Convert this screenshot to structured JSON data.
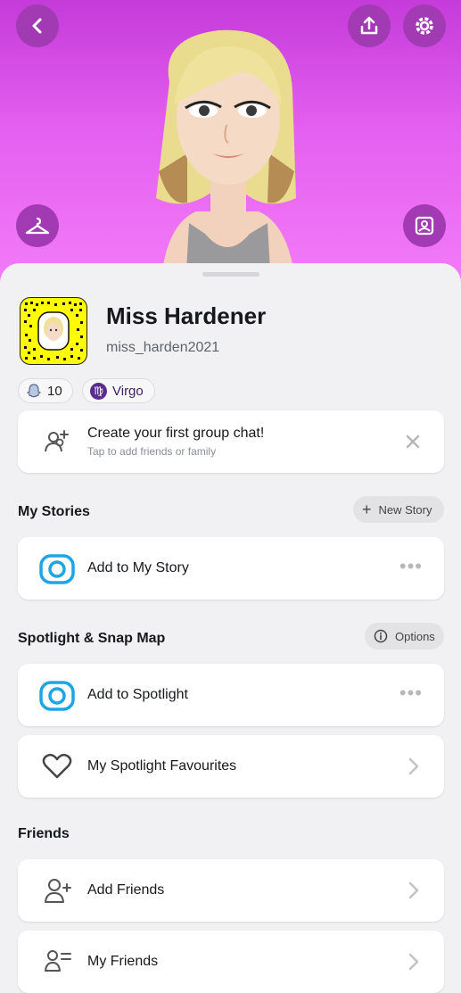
{
  "profile": {
    "display_name": "Miss Hardener",
    "username": "miss_harden2021",
    "friends_count": "10",
    "zodiac": "Virgo"
  },
  "header": {
    "icons": [
      "back-icon",
      "share-icon",
      "settings-icon",
      "hanger-icon",
      "gallery-icon"
    ]
  },
  "group_chat_card": {
    "title": "Create your first group chat!",
    "subtitle": "Tap to add friends or family"
  },
  "my_stories": {
    "title": "My Stories",
    "new_story_label": "New Story",
    "add_label": "Add to My Story"
  },
  "spotlight": {
    "title": "Spotlight & Snap Map",
    "options_label": "Options",
    "add_label": "Add to Spotlight",
    "favourites_label": "My Spotlight Favourites"
  },
  "friends": {
    "title": "Friends",
    "add_friends_label": "Add Friends",
    "my_friends_label": "My Friends"
  },
  "colors": {
    "hero_top": "#c43bd9",
    "hero_bottom": "#f27cf7",
    "snapcode_yellow": "#fffc00",
    "camera_blue": "#1ea5e6",
    "zodiac_purple": "#5b2c8f"
  }
}
